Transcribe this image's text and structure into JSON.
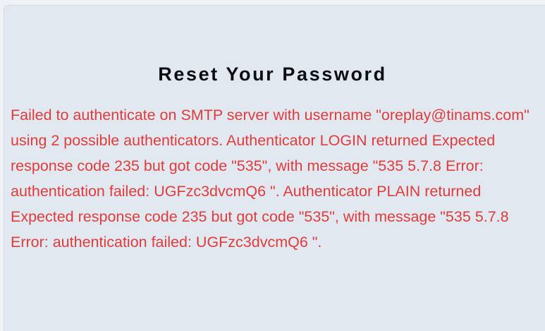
{
  "page": {
    "title": "Reset Your Password"
  },
  "error": {
    "message": "Failed to authenticate on SMTP server with username \"oreplay@tinams.com\" using 2 possible authenticators. Authenticator LOGIN returned Expected response code 235 but got code \"535\", with message \"535 5.7.8 Error: authentication failed: UGFzc3dvcmQ6 \". Authenticator PLAIN returned Expected response code 235 but got code \"535\", with message \"535 5.7.8 Error: authentication failed: UGFzc3dvcmQ6 \"."
  },
  "colors": {
    "page_background": "#eef1f6",
    "card_background": "#e2e8f0",
    "title_text": "#0b0d12",
    "error_text": "#e03b3b"
  }
}
